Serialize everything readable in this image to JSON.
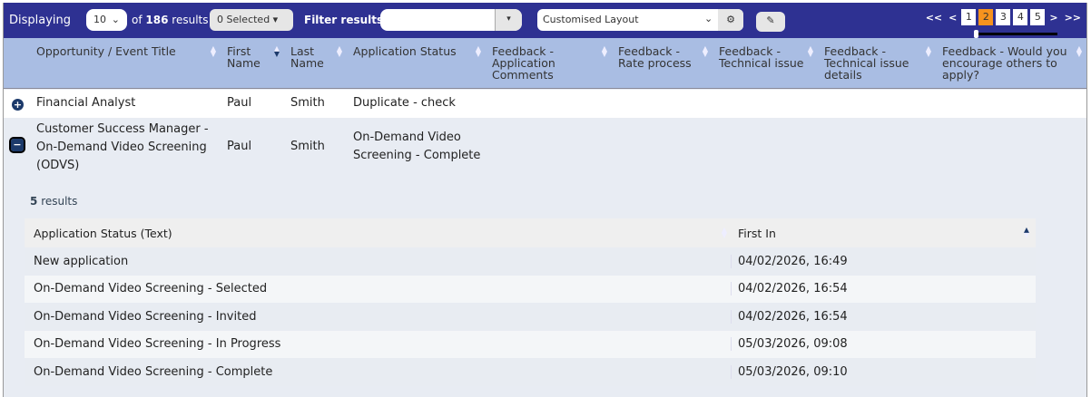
{
  "toolbar": {
    "displaying": "Displaying",
    "page_size": "10",
    "of": "of",
    "total": "186",
    "results": "results",
    "selected": "0 Selected",
    "filter_label": "Filter results",
    "filter_value": "",
    "layout": "Customised Layout"
  },
  "pagination": {
    "first": "<<",
    "prev": "<",
    "pages": [
      "1",
      "2",
      "3",
      "4",
      "5"
    ],
    "current": "2",
    "next": ">",
    "last": ">>",
    "accent": "#f7931e"
  },
  "columns": [
    "Opportunity / Event Title",
    "First Name",
    "Last Name",
    "Application Status",
    "Feedback - Application Comments",
    "Feedback - Rate process",
    "Feedback - Technical issue",
    "Feedback - Technical issue details",
    "Feedback - Would you encourage others to apply?"
  ],
  "rows": [
    {
      "title": "Financial Analyst",
      "first": "Paul",
      "last": "Smith",
      "status": "Duplicate - check"
    },
    {
      "title": "Customer Success Manager - On-Demand Video Screening (ODVS)",
      "first": "Paul",
      "last": "Smith",
      "status": "On-Demand Video Screening - Complete"
    }
  ],
  "detail": {
    "count": "5",
    "count_label": "results",
    "headers": [
      "Application Status (Text)",
      "First In"
    ],
    "rows": [
      [
        "New application",
        "04/02/2026, 16:49"
      ],
      [
        "On-Demand Video Screening - Selected",
        "04/02/2026, 16:54"
      ],
      [
        "On-Demand Video Screening - Invited",
        "04/02/2026, 16:54"
      ],
      [
        "On-Demand Video Screening - In Progress",
        "05/03/2026, 09:08"
      ],
      [
        "On-Demand Video Screening - Complete",
        "05/03/2026, 09:10"
      ]
    ]
  },
  "colors": {
    "topbar": "#2e3192",
    "header": "#a9bde3"
  }
}
